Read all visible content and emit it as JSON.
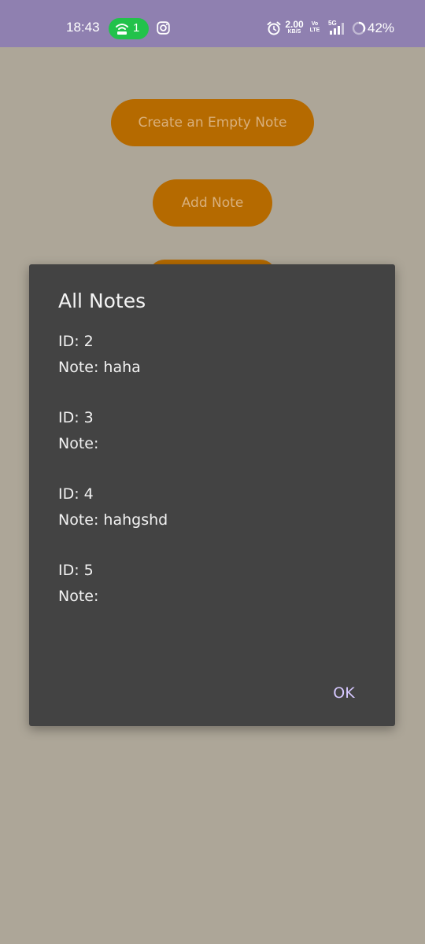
{
  "status_bar": {
    "time": "18:43",
    "hotspot_count": "1",
    "net_speed_value": "2.00",
    "net_speed_unit": "KB/S",
    "volte_top": "Vo",
    "volte_bottom": "LTE",
    "network_type": "5G",
    "battery_percent": "42%",
    "colors": {
      "bar": "#8f80b0",
      "hotspot_pill": "#22c24b"
    }
  },
  "main": {
    "create_empty_note_label": "Create an Empty Note",
    "add_note_label": "Add Note",
    "button_color": "#b56a00",
    "button_text_color": "#d9b07c",
    "background_color": "#ada698"
  },
  "dialog": {
    "title": "All Notes",
    "notes": [
      {
        "id_line": "ID: 2",
        "note_line": "Note: haha"
      },
      {
        "id_line": "ID: 3",
        "note_line": "Note:"
      },
      {
        "id_line": "ID: 4",
        "note_line": "Note: hahgshd"
      },
      {
        "id_line": "ID: 5",
        "note_line": "Note:"
      }
    ],
    "ok_label": "OK",
    "background_color": "#434343",
    "ok_color": "#d6c8ff"
  }
}
